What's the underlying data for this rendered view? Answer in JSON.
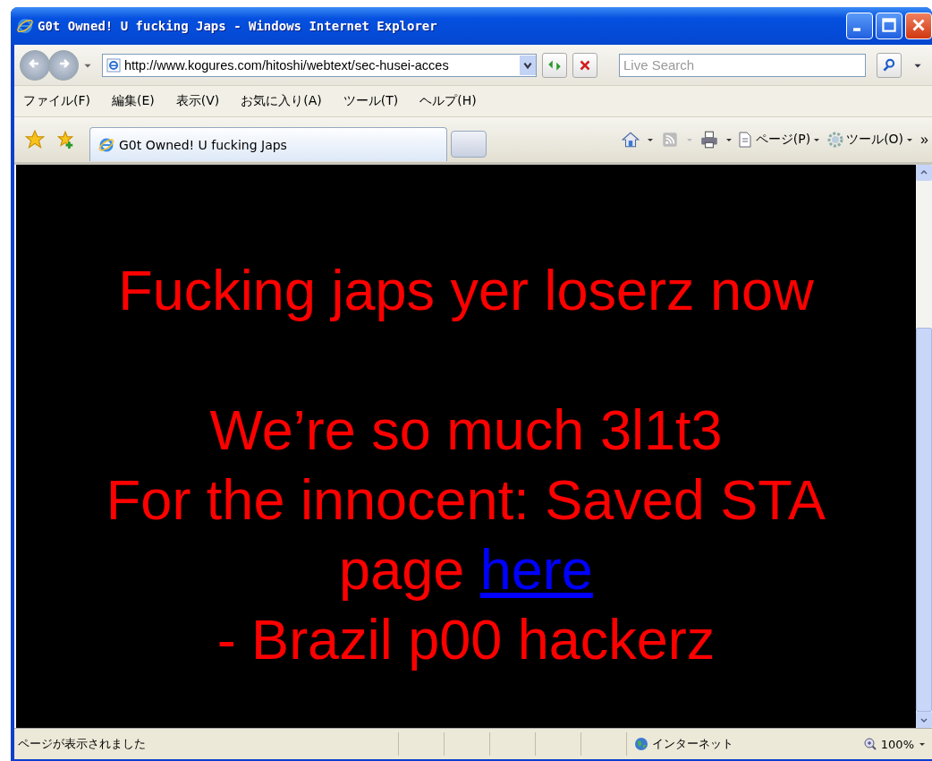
{
  "window": {
    "title": "G0t Owned! U fucking Japs - Windows Internet Explorer"
  },
  "address": {
    "url": "http://www.kogures.com/hitoshi/webtext/sec-husei-acces"
  },
  "search": {
    "placeholder": "Live Search"
  },
  "menu": [
    "ファイル(F)",
    "編集(E)",
    "表示(V)",
    "お気に入り(A)",
    "ツール(T)",
    "ヘルプ(H)"
  ],
  "tabs": [
    {
      "label": "G0t Owned! U fucking Japs",
      "selected": true
    }
  ],
  "toolbar": {
    "page_menu": "ページ(P)",
    "tools_menu": "ツール(O)",
    "more": "»"
  },
  "page": {
    "paragraphs": [
      {
        "lines": [
          {
            "text": "Fucking japs yer loserz now"
          }
        ]
      },
      {
        "lines": [
          {
            "text": "We’re so much 3l1t3"
          },
          {
            "text": "For the innocent: Saved STA"
          },
          {
            "text": "page ",
            "link": "here"
          },
          {
            "text": "- Brazil p00 hackerz"
          }
        ]
      }
    ]
  },
  "status_bar": {
    "text": "ページが表示されました",
    "zone": "インターネット",
    "zoom": "100%"
  }
}
